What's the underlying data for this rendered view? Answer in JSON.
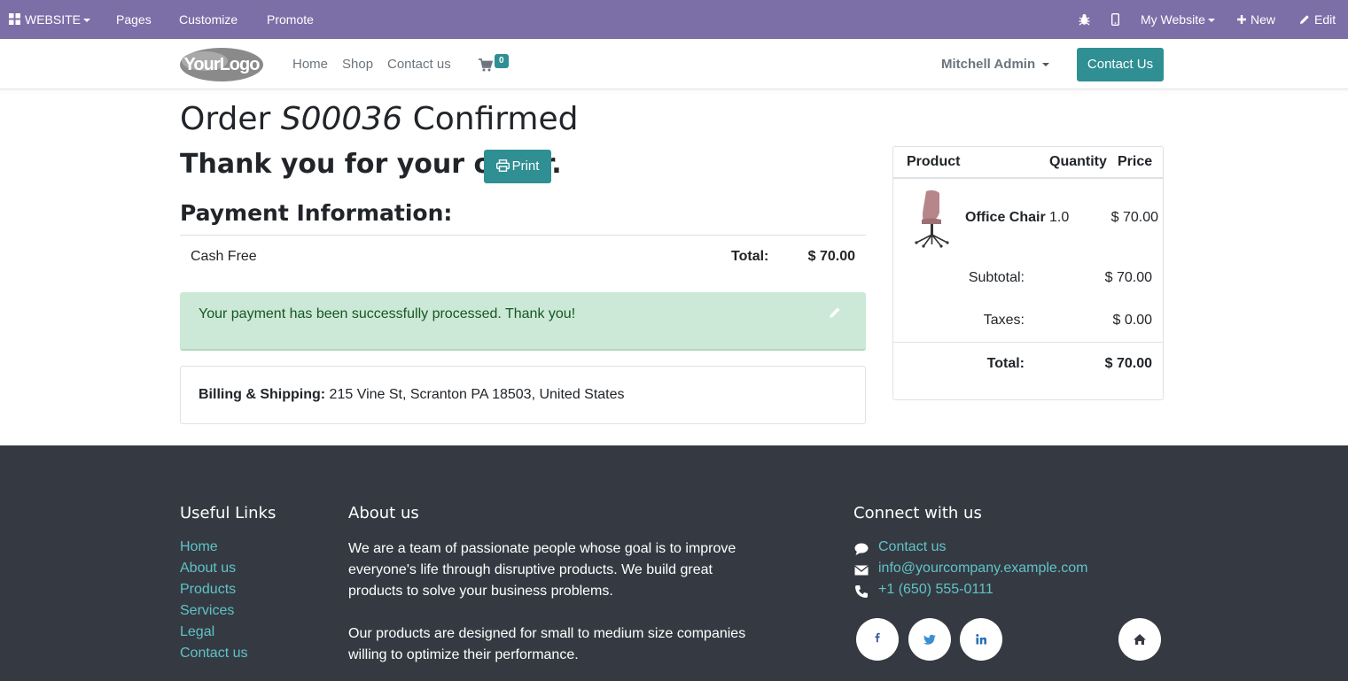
{
  "admin_bar": {
    "website_menu": "WEBSITE",
    "pages": "Pages",
    "customize": "Customize",
    "promote": "Promote",
    "website_selector": "My Website",
    "new_label": "New",
    "edit_label": "Edit",
    "background_color": "#7c6fa8"
  },
  "header": {
    "logo_text": "YourLogo",
    "nav": [
      "Home",
      "Shop",
      "Contact us"
    ],
    "cart_count": "0",
    "user_name": "Mitchell Admin",
    "contact_button": "Contact Us",
    "accent_color": "#2f8f93"
  },
  "order": {
    "title_prefix": "Order",
    "order_ref": "S00036",
    "title_suffix": "Confirmed",
    "thank_you": "Thank you for your order.",
    "print_label": "Print",
    "payment_heading": "Payment Information:",
    "payment_method": "Cash Free",
    "total_label": "Total:",
    "total_value": "$ 70.00",
    "success_message": "Your payment has been successfully processed. Thank you!",
    "billing_label": "Billing & Shipping:",
    "billing_address": "215 Vine St, Scranton PA 18503, United States"
  },
  "summary": {
    "headers": [
      "Product",
      "Quantity",
      "Price"
    ],
    "item": {
      "name": "Office Chair",
      "quantity": "1.0",
      "price": "$ 70.00"
    },
    "subtotal_label": "Subtotal:",
    "subtotal_value": "$ 70.00",
    "taxes_label": "Taxes:",
    "taxes_value": "$ 0.00",
    "total_label": "Total:",
    "total_value": "$ 70.00"
  },
  "footer": {
    "useful_links_title": "Useful Links",
    "useful_links": [
      "Home",
      "About us",
      "Products",
      "Services",
      "Legal",
      "Contact us"
    ],
    "about_title": "About us",
    "about_p1": "We are a team of passionate people whose goal is to improve everyone's life through disruptive products. We build great products to solve your business problems.",
    "about_p2": "Our products are designed for small to medium size companies willing to optimize their performance.",
    "connect_title": "Connect with us",
    "contact_link": "Contact us",
    "email": "info@yourcompany.example.com",
    "phone": "+1 (650) 555-0111",
    "social_icons": [
      "facebook-icon",
      "twitter-icon",
      "linkedin-icon",
      "home-icon"
    ],
    "background_color": "#353a42",
    "link_color": "#5fc3c8"
  }
}
